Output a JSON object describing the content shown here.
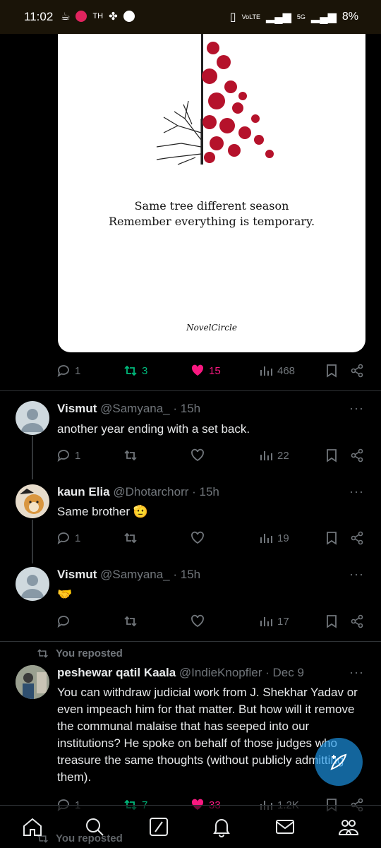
{
  "status_bar": {
    "time": "11:02",
    "carrier_text": "TH",
    "net_text": "VoLTE",
    "signal_text": "5G",
    "battery": "8%"
  },
  "media_post": {
    "quote_line1": "Same tree different season",
    "quote_line2": "Remember everything is temporary.",
    "brand": "NovelCircle",
    "replies": "1",
    "reposts": "3",
    "likes": "15",
    "views": "468"
  },
  "comments": [
    {
      "name": "Vismut",
      "handle": "@Samyana_",
      "time": "· 15h",
      "text": "another year ending with a set back.",
      "replies": "1",
      "views": "22"
    },
    {
      "name": "kaun Elia",
      "handle": "@Dhotarchorr",
      "time": "· 15h",
      "text": "Same brother",
      "emoji": "🫡",
      "replies": "1",
      "views": "19"
    },
    {
      "name": "Vismut",
      "handle": "@Samyana_",
      "time": "· 15h",
      "emoji": "🤝",
      "views": "17"
    }
  ],
  "repost": {
    "label": "You reposted",
    "name": "peshewar qatil Kaala",
    "handle": "@IndieKnopfler",
    "time": "· Dec 9",
    "text": "You can withdraw judicial work from J. Shekhar Yadav or even impeach him for that matter. But how will it remove the communal malaise that has seeped into our institutions? He spoke on behalf of those judges who treasure the same thoughts (without publicly admitting them).",
    "replies": "1",
    "reposts": "7",
    "likes": "33",
    "views": "1.2K"
  },
  "next_repost_label": "You reposted",
  "more_glyph": "···",
  "colors": {
    "accent": "#1d9bf0",
    "like": "#f91880",
    "repost": "#00ba7c",
    "muted": "#71767b"
  }
}
